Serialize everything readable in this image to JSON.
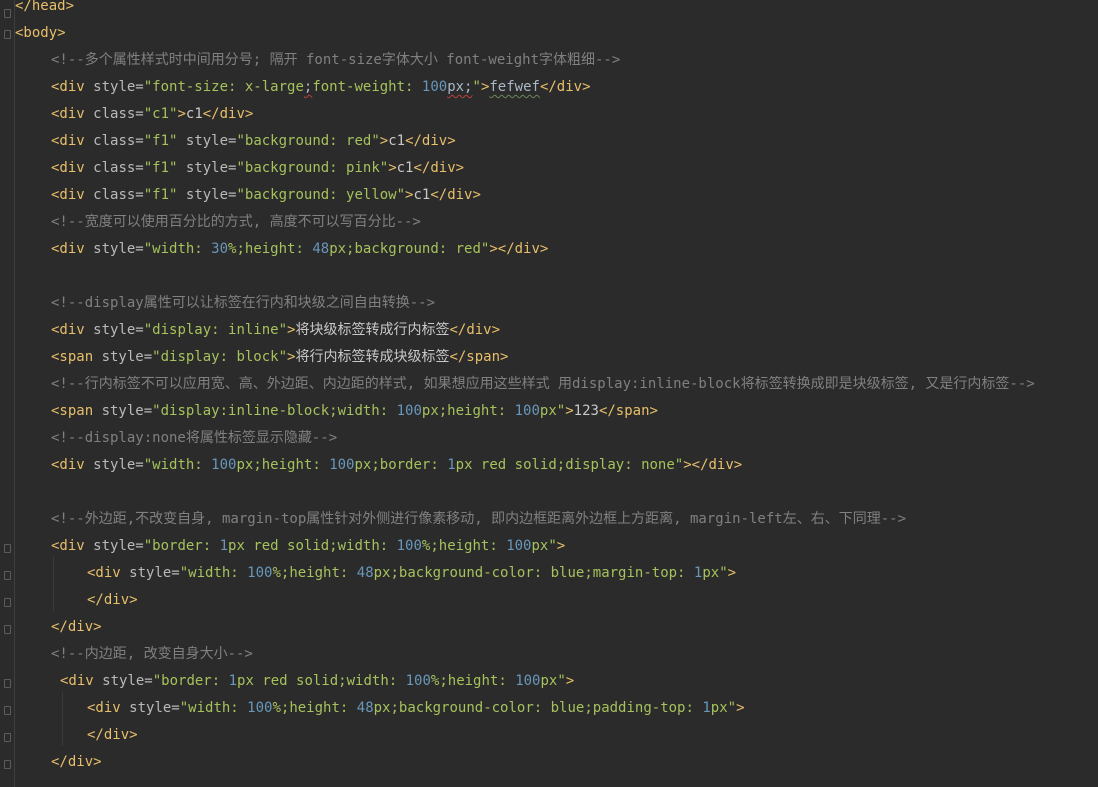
{
  "lines": [
    {
      "id": "l1",
      "parts": [
        [
          "tag",
          "</head>"
        ]
      ]
    },
    {
      "id": "l2",
      "parts": [
        [
          "tag",
          "<body>"
        ]
      ]
    },
    {
      "id": "l3",
      "parts": [
        [
          "cmt",
          "<!--多个属性样式时中间用分号; 隔开 font-size字体大小 font-weight字体粗细-->"
        ]
      ]
    },
    {
      "id": "l4",
      "parts": [
        [
          "tag",
          "<div "
        ],
        [
          "attr",
          "style="
        ],
        [
          "val",
          "\"font-size: x-large"
        ],
        [
          "squig",
          ";"
        ],
        [
          "val",
          "font-weight: "
        ],
        [
          "num",
          "100"
        ],
        [
          "squig",
          "px;"
        ],
        [
          "val",
          "\""
        ],
        [
          "tag",
          ">"
        ],
        [
          "squig-green",
          "fefwef"
        ],
        [
          "tag",
          "</div>"
        ]
      ]
    },
    {
      "id": "l5",
      "parts": [
        [
          "tag",
          "<div "
        ],
        [
          "attr",
          "class="
        ],
        [
          "val",
          "\"c1\""
        ],
        [
          "tag",
          ">"
        ],
        [
          "txt",
          "c1"
        ],
        [
          "tag",
          "</div>"
        ]
      ]
    },
    {
      "id": "l6",
      "parts": [
        [
          "tag",
          "<div "
        ],
        [
          "attr",
          "class="
        ],
        [
          "val",
          "\"f1\" "
        ],
        [
          "attr",
          "style="
        ],
        [
          "val",
          "\"background: red\""
        ],
        [
          "tag",
          ">"
        ],
        [
          "txt",
          "c1"
        ],
        [
          "tag",
          "</div>"
        ]
      ]
    },
    {
      "id": "l7",
      "parts": [
        [
          "tag",
          "<div "
        ],
        [
          "attr",
          "class="
        ],
        [
          "val",
          "\"f1\" "
        ],
        [
          "attr",
          "style="
        ],
        [
          "val",
          "\"background: pink\""
        ],
        [
          "tag",
          ">"
        ],
        [
          "txt",
          "c1"
        ],
        [
          "tag",
          "</div>"
        ]
      ]
    },
    {
      "id": "l8",
      "parts": [
        [
          "tag",
          "<div "
        ],
        [
          "attr",
          "class="
        ],
        [
          "val",
          "\"f1\" "
        ],
        [
          "attr",
          "style="
        ],
        [
          "val",
          "\"background: yellow\""
        ],
        [
          "tag",
          ">"
        ],
        [
          "txt",
          "c1"
        ],
        [
          "tag",
          "</div>"
        ]
      ]
    },
    {
      "id": "l9",
      "parts": [
        [
          "cmt",
          "<!--宽度可以使用百分比的方式, 高度不可以写百分比-->"
        ]
      ]
    },
    {
      "id": "l10",
      "parts": [
        [
          "tag",
          "<div "
        ],
        [
          "attr",
          "style="
        ],
        [
          "val",
          "\"width: "
        ],
        [
          "num",
          "30"
        ],
        [
          "val",
          "%;height: "
        ],
        [
          "num",
          "48"
        ],
        [
          "val",
          "px;background: red\""
        ],
        [
          "tag",
          "></div>"
        ]
      ]
    },
    {
      "id": "l11",
      "parts": []
    },
    {
      "id": "l12",
      "parts": [
        [
          "cmt",
          "<!--display属性可以让标签在行内和块级之间自由转换-->"
        ]
      ]
    },
    {
      "id": "l13",
      "parts": [
        [
          "tag",
          "<div "
        ],
        [
          "attr",
          "style="
        ],
        [
          "val",
          "\"display: inline\""
        ],
        [
          "tag",
          ">"
        ],
        [
          "txt",
          "将块级标签转成行内标签"
        ],
        [
          "tag",
          "</div>"
        ]
      ]
    },
    {
      "id": "l14",
      "parts": [
        [
          "tag",
          "<span "
        ],
        [
          "attr",
          "style="
        ],
        [
          "val",
          "\"display: block\""
        ],
        [
          "tag",
          ">"
        ],
        [
          "txt",
          "将行内标签转成块级标签"
        ],
        [
          "tag",
          "</span>"
        ]
      ]
    },
    {
      "id": "l15",
      "parts": [
        [
          "cmt",
          "<!--行内标签不可以应用宽、高、外边距、内边距的样式, 如果想应用这些样式 用display:inline-block将标签转换成即是块级标签, 又是行内标签-->"
        ]
      ]
    },
    {
      "id": "l16",
      "parts": [
        [
          "tag",
          "<span "
        ],
        [
          "attr",
          "style="
        ],
        [
          "val",
          "\"display:inline-block;width: "
        ],
        [
          "num",
          "100"
        ],
        [
          "val",
          "px;height: "
        ],
        [
          "num",
          "100"
        ],
        [
          "val",
          "px\""
        ],
        [
          "tag",
          ">"
        ],
        [
          "txt",
          "123"
        ],
        [
          "tag",
          "</span>"
        ]
      ]
    },
    {
      "id": "l17",
      "parts": [
        [
          "cmt",
          "<!--display:none将属性标签显示隐藏-->"
        ]
      ]
    },
    {
      "id": "l18",
      "parts": [
        [
          "tag",
          "<div "
        ],
        [
          "attr",
          "style="
        ],
        [
          "val",
          "\"width: "
        ],
        [
          "num",
          "100"
        ],
        [
          "val",
          "px;height: "
        ],
        [
          "num",
          "100"
        ],
        [
          "val",
          "px;border: "
        ],
        [
          "num",
          "1"
        ],
        [
          "val",
          "px red solid;display: none\""
        ],
        [
          "tag",
          "></div>"
        ]
      ]
    },
    {
      "id": "l19",
      "parts": []
    },
    {
      "id": "l20",
      "parts": [
        [
          "cmt",
          "<!--外边距,不改变自身, margin-top属性针对外侧进行像素移动, 即内边框距离外边框上方距离, margin-left左、右、下同理-->"
        ]
      ]
    },
    {
      "id": "l21",
      "parts": [
        [
          "tag",
          "<div "
        ],
        [
          "attr",
          "style="
        ],
        [
          "val",
          "\"border: "
        ],
        [
          "num",
          "1"
        ],
        [
          "val",
          "px red solid;width: "
        ],
        [
          "num",
          "100"
        ],
        [
          "val",
          "%;height: "
        ],
        [
          "num",
          "100"
        ],
        [
          "val",
          "px\""
        ],
        [
          "tag",
          ">"
        ]
      ]
    },
    {
      "id": "l22",
      "parts": [
        [
          "tag",
          "<div "
        ],
        [
          "attr",
          "style="
        ],
        [
          "val",
          "\"width: "
        ],
        [
          "num",
          "100"
        ],
        [
          "val",
          "%;height: "
        ],
        [
          "num",
          "48"
        ],
        [
          "val",
          "px;background-color: blue;margin-top: "
        ],
        [
          "num",
          "1"
        ],
        [
          "val",
          "px\""
        ],
        [
          "tag",
          ">"
        ]
      ]
    },
    {
      "id": "l23",
      "parts": [
        [
          "tag",
          "</div>"
        ]
      ]
    },
    {
      "id": "l24",
      "parts": [
        [
          "tag",
          "</div>"
        ]
      ]
    },
    {
      "id": "l25",
      "parts": [
        [
          "cmt",
          "<!--内边距, 改变自身大小-->"
        ]
      ]
    },
    {
      "id": "l26",
      "parts": [
        [
          "tag",
          "<div "
        ],
        [
          "attr",
          "style="
        ],
        [
          "val",
          "\"border: "
        ],
        [
          "num",
          "1"
        ],
        [
          "val",
          "px red solid;width: "
        ],
        [
          "num",
          "100"
        ],
        [
          "val",
          "%;height: "
        ],
        [
          "num",
          "100"
        ],
        [
          "val",
          "px\""
        ],
        [
          "tag",
          ">"
        ]
      ]
    },
    {
      "id": "l27",
      "parts": [
        [
          "tag",
          "<div "
        ],
        [
          "attr",
          "style="
        ],
        [
          "val",
          "\"width: "
        ],
        [
          "num",
          "100"
        ],
        [
          "val",
          "%;height: "
        ],
        [
          "num",
          "48"
        ],
        [
          "val",
          "px;background-color: blue;padding-top: "
        ],
        [
          "num",
          "1"
        ],
        [
          "val",
          "px\""
        ],
        [
          "tag",
          ">"
        ]
      ]
    },
    {
      "id": "l28",
      "parts": [
        [
          "tag",
          "</div>"
        ]
      ]
    },
    {
      "id": "l29",
      "parts": [
        [
          "tag",
          "</div>"
        ]
      ]
    }
  ]
}
